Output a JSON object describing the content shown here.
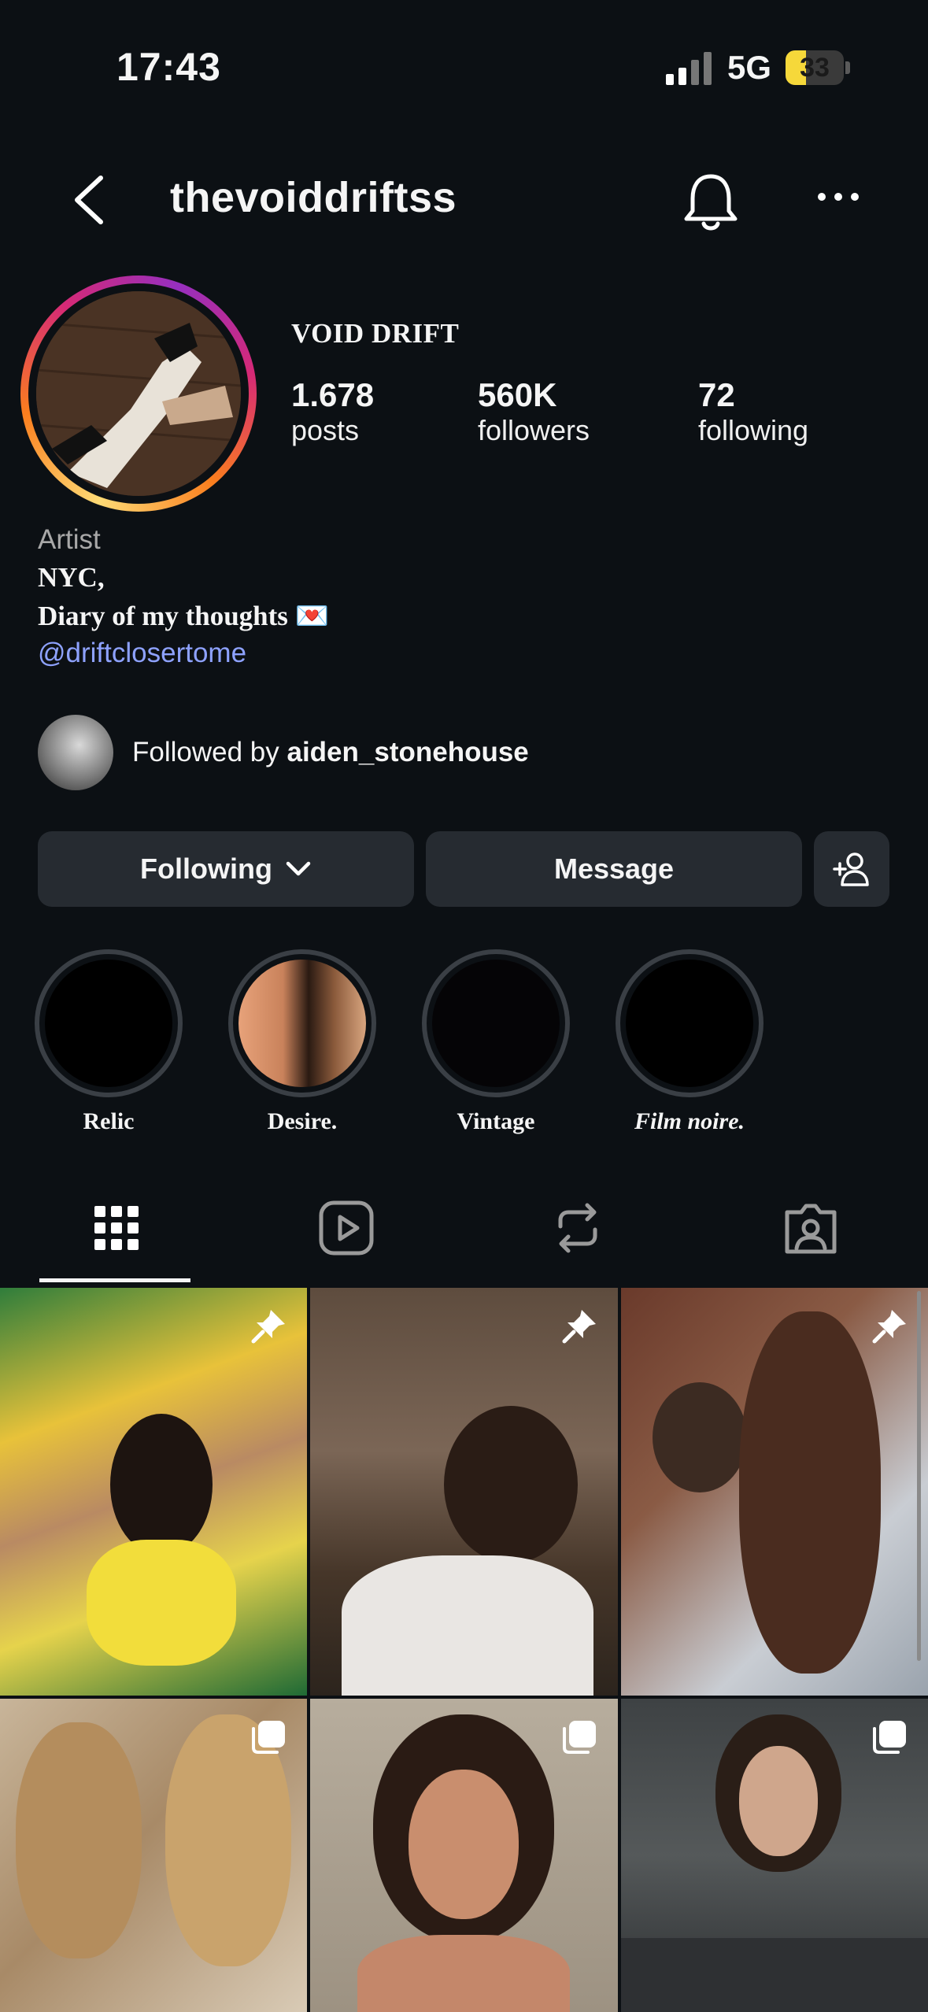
{
  "status_bar": {
    "time": "17:43",
    "network": "5G",
    "battery": "33"
  },
  "header": {
    "username": "thevoiddriftss"
  },
  "profile": {
    "display_name": "VOID DRIFT",
    "stats": [
      {
        "value": "1.678",
        "label": "posts"
      },
      {
        "value": "560K",
        "label": "followers"
      },
      {
        "value": "72",
        "label": "following"
      }
    ]
  },
  "bio": {
    "category": "Artist",
    "line1": "NYC,",
    "line2": "Diary of my thoughts 💌",
    "link": "@driftclosertome"
  },
  "followed_by": {
    "prefix": "Followed by ",
    "name": "aiden_stonehouse"
  },
  "buttons": {
    "following": "Following",
    "message": "Message"
  },
  "highlights": [
    {
      "label": "Relic"
    },
    {
      "label": "Desire."
    },
    {
      "label": "Vintage"
    },
    {
      "label": "Film noire."
    }
  ],
  "tabs": [
    "grid-icon",
    "reels-icon",
    "reposts-icon",
    "tagged-icon"
  ],
  "colors": {
    "background": "#0c1014",
    "button": "#262b31",
    "link": "#8ea2ff"
  }
}
